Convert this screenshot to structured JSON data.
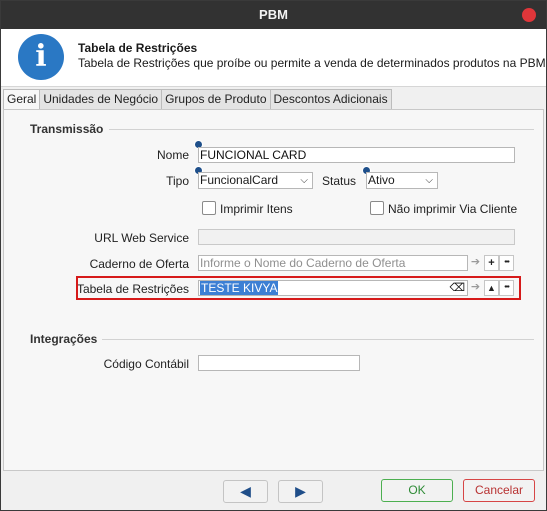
{
  "window": {
    "title": "PBM"
  },
  "header": {
    "title": "Tabela de Restrições",
    "subtitle": "Tabela de Restrições que proíbe ou permite a venda de determinados produtos na PBM",
    "icon": "info-icon",
    "icon_glyph": "i",
    "icon_color": "#2a78c4"
  },
  "tabs": [
    {
      "label": "Geral",
      "active": true
    },
    {
      "label": "Unidades de Negócio",
      "active": false
    },
    {
      "label": "Grupos de Produto",
      "active": false
    },
    {
      "label": "Descontos Adicionais",
      "active": false
    }
  ],
  "transmissao": {
    "section_title": "Transmissão",
    "nome": {
      "label": "Nome",
      "value": "FUNCIONAL CARD"
    },
    "tipo": {
      "label": "Tipo",
      "value": "FuncionalCard"
    },
    "status": {
      "label": "Status",
      "value": "Ativo"
    },
    "imprimir_itens": {
      "label": "Imprimir Itens",
      "checked": false
    },
    "nao_imprimir": {
      "label": "Não imprimir Via Cliente",
      "checked": false
    },
    "url": {
      "label": "URL Web Service",
      "value": ""
    },
    "caderno": {
      "label": "Caderno de Oferta",
      "placeholder": "Informe o Nome do Caderno de Oferta"
    },
    "tabela": {
      "label": "Tabela de Restrições",
      "value": "TESTE KIVYA"
    }
  },
  "integracoes": {
    "section_title": "Integrações",
    "codigo": {
      "label": "Código Contábil",
      "value": ""
    }
  },
  "footer": {
    "prev_glyph": "◀",
    "next_glyph": "▶",
    "ok_label": "OK",
    "cancel_label": "Cancelar"
  },
  "glyphs": {
    "go": "➔",
    "add": "+",
    "more": "•••",
    "up": "▲",
    "clear": "⌫",
    "dropdown": "⌵"
  },
  "colors": {
    "ok_border": "#4caf50",
    "cancel_border": "#d64545",
    "highlight": "#d61a1a",
    "selection": "#3c7fd4"
  }
}
